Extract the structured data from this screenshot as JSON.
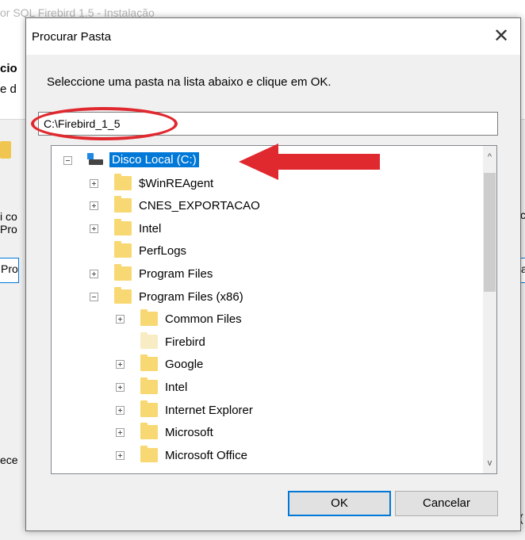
{
  "background": {
    "title_fragment": "or SQL Firebird 1.5 - Instalação",
    "heading_fragment": "cio",
    "sub_fragment": "e d",
    "left_text1": "i co",
    "left_text2": "Pro",
    "left_field": "Pro",
    "left_text3": "ece",
    "right_text1": "ch",
    "right_field": "a",
    "right_cut": "("
  },
  "dialog": {
    "title": "Procurar Pasta",
    "close_glyph": "✕",
    "instruction": "Seleccione uma pasta na lista abaixo e clique em OK.",
    "path_value": "C:\\Firebird_1_5",
    "tree": {
      "root": {
        "label": "Disco Local (C:)",
        "expanded": true,
        "selected": true
      },
      "items": [
        {
          "label": "$WinREAgent",
          "level": 1,
          "expander": "plus",
          "folder": "normal"
        },
        {
          "label": "CNES_EXPORTACAO",
          "level": 1,
          "expander": "plus",
          "folder": "normal"
        },
        {
          "label": "Intel",
          "level": 1,
          "expander": "plus",
          "folder": "normal"
        },
        {
          "label": "PerfLogs",
          "level": 1,
          "expander": "none",
          "folder": "normal"
        },
        {
          "label": "Program Files",
          "level": 1,
          "expander": "plus",
          "folder": "normal"
        },
        {
          "label": "Program Files (x86)",
          "level": 1,
          "expander": "minus",
          "folder": "normal"
        },
        {
          "label": "Common Files",
          "level": 2,
          "expander": "plus",
          "folder": "normal"
        },
        {
          "label": "Firebird",
          "level": 2,
          "expander": "none",
          "folder": "light"
        },
        {
          "label": "Google",
          "level": 2,
          "expander": "plus",
          "folder": "normal"
        },
        {
          "label": "Intel",
          "level": 2,
          "expander": "plus",
          "folder": "normal"
        },
        {
          "label": "Internet Explorer",
          "level": 2,
          "expander": "plus",
          "folder": "normal"
        },
        {
          "label": "Microsoft",
          "level": 2,
          "expander": "plus",
          "folder": "normal"
        },
        {
          "label": "Microsoft Office",
          "level": 2,
          "expander": "plus",
          "folder": "normal"
        }
      ]
    },
    "scroll_up_glyph": "^",
    "scroll_down_glyph": "v",
    "ok_label": "OK",
    "cancel_label": "Cancelar"
  },
  "colors": {
    "selection": "#0078d7",
    "annotation_red": "#e0282f",
    "folder": "#f8d873"
  }
}
